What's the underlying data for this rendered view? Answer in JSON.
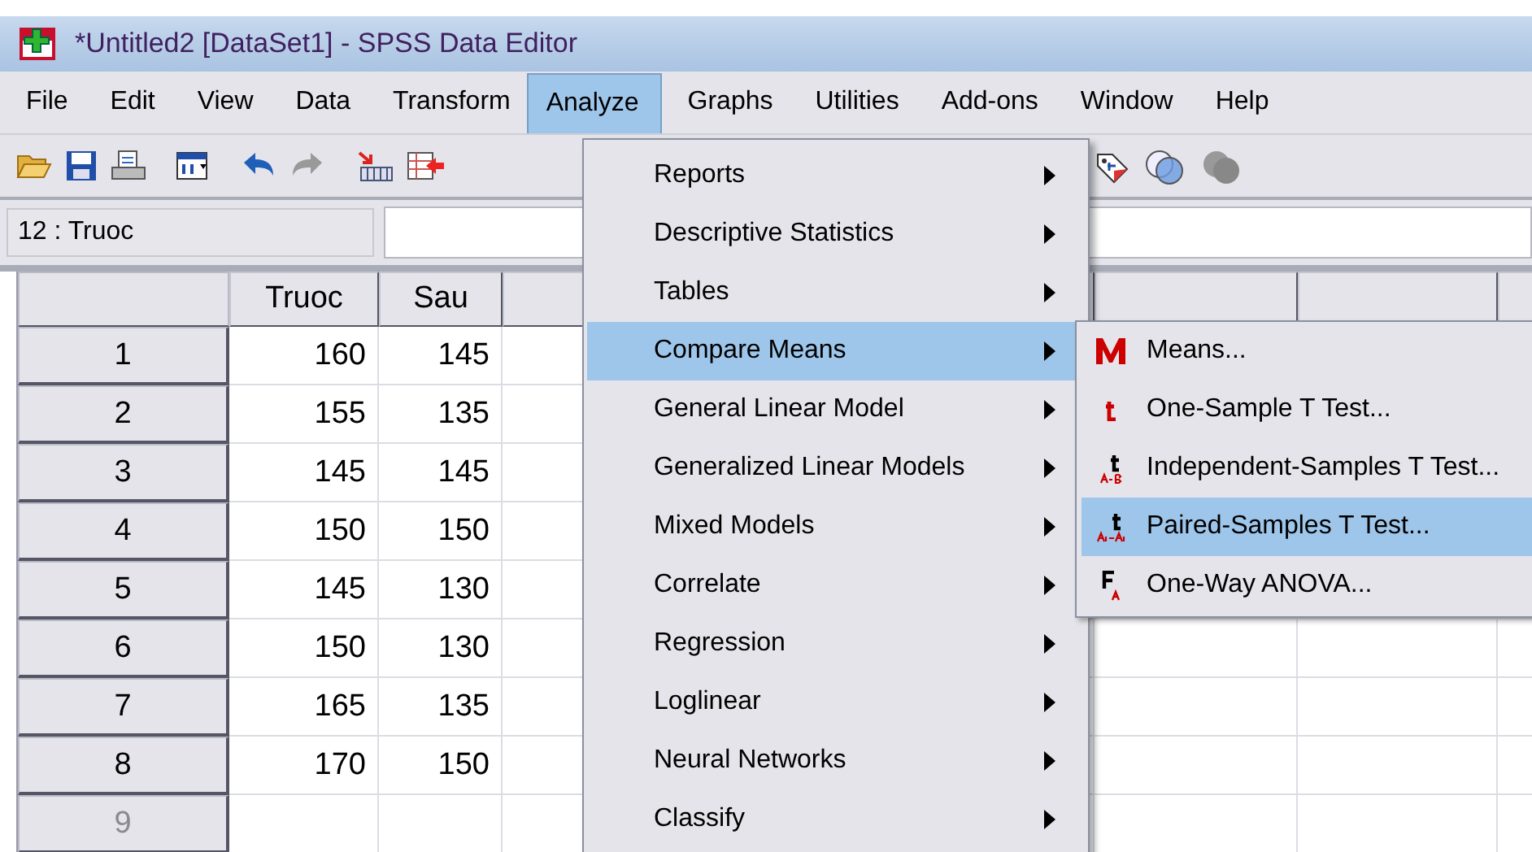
{
  "window": {
    "title": "*Untitled2 [DataSet1] - SPSS Data Editor"
  },
  "menubar": [
    {
      "label": "File",
      "selected": false
    },
    {
      "label": "Edit",
      "selected": false
    },
    {
      "label": "View",
      "selected": false
    },
    {
      "label": "Data",
      "selected": false
    },
    {
      "label": "Transform",
      "selected": false
    },
    {
      "label": "Analyze",
      "selected": true
    },
    {
      "label": "Graphs",
      "selected": false
    },
    {
      "label": "Utilities",
      "selected": false
    },
    {
      "label": "Add-ons",
      "selected": false
    },
    {
      "label": "Window",
      "selected": false
    },
    {
      "label": "Help",
      "selected": false
    }
  ],
  "cell_reference": "12 : Truoc",
  "grid": {
    "columns": [
      "Truoc",
      "Sau"
    ],
    "rows": [
      {
        "number": "1",
        "cells": [
          "160",
          "145"
        ],
        "greyed": false
      },
      {
        "number": "2",
        "cells": [
          "155",
          "135"
        ],
        "greyed": false
      },
      {
        "number": "3",
        "cells": [
          "145",
          "145"
        ],
        "greyed": false
      },
      {
        "number": "4",
        "cells": [
          "150",
          "150"
        ],
        "greyed": false
      },
      {
        "number": "5",
        "cells": [
          "145",
          "130"
        ],
        "greyed": false
      },
      {
        "number": "6",
        "cells": [
          "150",
          "130"
        ],
        "greyed": false
      },
      {
        "number": "7",
        "cells": [
          "165",
          "135"
        ],
        "greyed": false
      },
      {
        "number": "8",
        "cells": [
          "170",
          "150"
        ],
        "greyed": false
      },
      {
        "number": "9",
        "cells": [],
        "greyed": true
      }
    ]
  },
  "analyze_menu": [
    {
      "label": "Reports",
      "selected": false
    },
    {
      "label": "Descriptive Statistics",
      "selected": false
    },
    {
      "label": "Tables",
      "selected": false
    },
    {
      "label": "Compare Means",
      "selected": true
    },
    {
      "label": "General Linear Model",
      "selected": false
    },
    {
      "label": "Generalized Linear Models",
      "selected": false
    },
    {
      "label": "Mixed Models",
      "selected": false
    },
    {
      "label": "Correlate",
      "selected": false
    },
    {
      "label": "Regression",
      "selected": false
    },
    {
      "label": "Loglinear",
      "selected": false
    },
    {
      "label": "Neural Networks",
      "selected": false
    },
    {
      "label": "Classify",
      "selected": false
    }
  ],
  "compare_means_submenu": [
    {
      "kind": "means",
      "label": "Means...",
      "selected": false
    },
    {
      "kind": "t",
      "label": "One-Sample T Test...",
      "selected": false
    },
    {
      "kind": "t-ab",
      "label": "Independent-Samples T Test...",
      "selected": false
    },
    {
      "kind": "t-paired",
      "label": "Paired-Samples T Test...",
      "selected": true
    },
    {
      "kind": "f",
      "label": "One-Way ANOVA...",
      "selected": false
    }
  ]
}
